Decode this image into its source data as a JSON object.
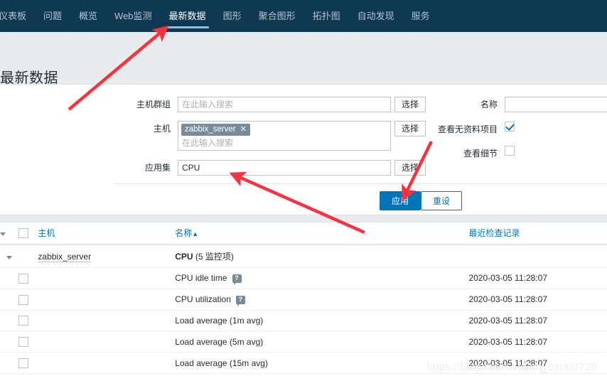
{
  "nav": {
    "items": [
      {
        "label": "仪表板",
        "active": false
      },
      {
        "label": "问题",
        "active": false
      },
      {
        "label": "概览",
        "active": false
      },
      {
        "label": "Web监测",
        "active": false
      },
      {
        "label": "最新数据",
        "active": true
      },
      {
        "label": "图形",
        "active": false
      },
      {
        "label": "聚合图形",
        "active": false
      },
      {
        "label": "拓扑图",
        "active": false
      },
      {
        "label": "自动发现",
        "active": false
      },
      {
        "label": "服务",
        "active": false
      }
    ]
  },
  "header": {
    "title": "最新数据"
  },
  "filter": {
    "hostgroup": {
      "label": "主机群组",
      "value": "",
      "placeholder": "在此输入搜索",
      "select_label": "选择"
    },
    "host": {
      "label": "主机",
      "chips": [
        "zabbix_server"
      ],
      "chip_remove_icon": "✕",
      "placeholder": "在此输入搜索",
      "select_label": "选择"
    },
    "application": {
      "label": "应用集",
      "value": "CPU",
      "placeholder": "",
      "select_label": "选择"
    },
    "name": {
      "label": "名称",
      "value": "",
      "placeholder": ""
    },
    "show_no_data": {
      "label": "查看无资料项目",
      "checked": true
    },
    "show_details": {
      "label": "查看细节",
      "checked": false
    },
    "apply_label": "应用",
    "reset_label": "重设"
  },
  "table": {
    "columns": {
      "host": "主机",
      "name": "名称",
      "sort_indicator": "▲",
      "last_check": "最近检查记录"
    },
    "group_row": {
      "host": "zabbix_server",
      "application": "CPU",
      "item_count_text": "(5 监控项)"
    },
    "rows": [
      {
        "name": "CPU idle time",
        "has_help": true,
        "help_icon": "?",
        "last_check": "2020-03-05 11:28:07"
      },
      {
        "name": "CPU utilization",
        "has_help": true,
        "help_icon": "?",
        "last_check": "2020-03-05 11:28:07"
      },
      {
        "name": "Load average (1m avg)",
        "has_help": false,
        "help_icon": "",
        "last_check": "2020-03-05 11:28:07"
      },
      {
        "name": "Load average (5m avg)",
        "has_help": false,
        "help_icon": "",
        "last_check": "2020-03-05 11:28:07"
      },
      {
        "name": "Load average (15m avg)",
        "has_help": false,
        "help_icon": "",
        "last_check": "2020-03-05 11:28:07"
      }
    ]
  },
  "watermark": {
    "text": "https://blog.csdn.net/qq_01009726"
  },
  "colors": {
    "nav_background": "#0f3852",
    "nav_active_underline": "#86c0e8",
    "accent_blue": "#0275b8",
    "header_band": "#e8ebee",
    "chip_background": "#768d99",
    "annotation_red": "#f5333f"
  }
}
